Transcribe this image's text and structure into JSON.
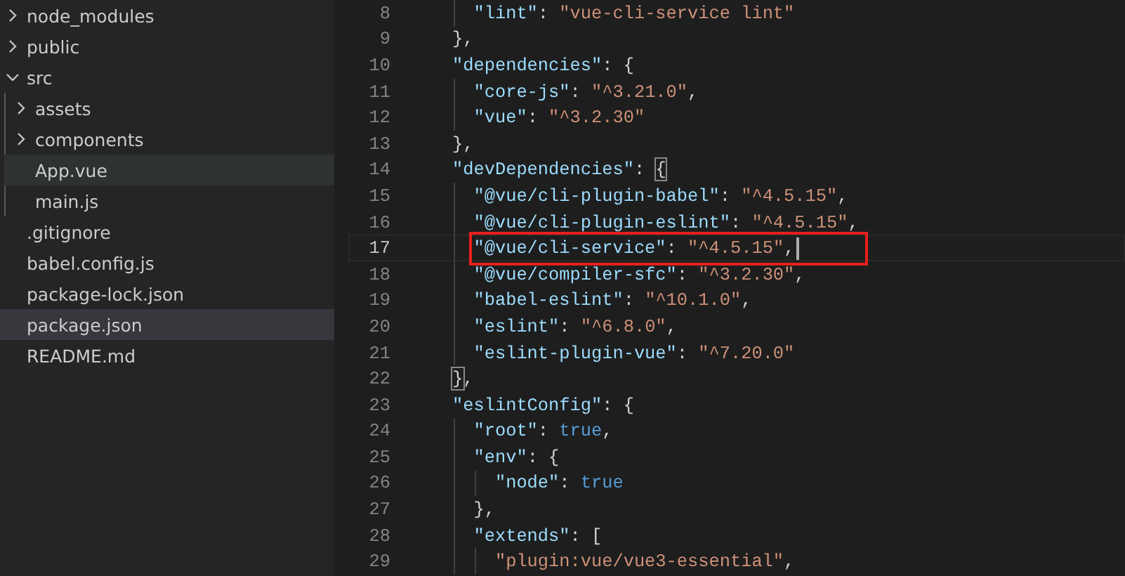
{
  "explorer": {
    "items": [
      {
        "kind": "folder",
        "label": "node_modules",
        "expanded": false,
        "selected": false,
        "hovered": false
      },
      {
        "kind": "folder",
        "label": "public",
        "expanded": false,
        "selected": false,
        "hovered": false
      },
      {
        "kind": "folder",
        "label": "src",
        "expanded": true,
        "selected": false,
        "hovered": false,
        "children": [
          {
            "kind": "folder",
            "label": "assets",
            "expanded": false,
            "selected": false,
            "hovered": false
          },
          {
            "kind": "folder",
            "label": "components",
            "expanded": false,
            "selected": false,
            "hovered": false
          },
          {
            "kind": "file",
            "label": "App.vue",
            "selected": false,
            "hovered": true
          },
          {
            "kind": "file",
            "label": "main.js",
            "selected": false,
            "hovered": false
          }
        ]
      },
      {
        "kind": "file",
        "label": ".gitignore",
        "selected": false,
        "hovered": false
      },
      {
        "kind": "file",
        "label": "babel.config.js",
        "selected": false,
        "hovered": false
      },
      {
        "kind": "file",
        "label": "package-lock.json",
        "selected": false,
        "hovered": false
      },
      {
        "kind": "file",
        "label": "package.json",
        "selected": true,
        "hovered": false
      },
      {
        "kind": "file",
        "label": "README.md",
        "selected": false,
        "hovered": false
      }
    ]
  },
  "editor": {
    "lines": [
      {
        "number": "8",
        "active": false,
        "boxed": false,
        "tokens": [
          {
            "kind": "key",
            "text": "    \"lint\""
          },
          {
            "kind": "punct",
            "text": ": "
          },
          {
            "kind": "string",
            "text": "\"vue-cli-service lint\""
          }
        ]
      },
      {
        "number": "9",
        "active": false,
        "boxed": false,
        "tokens": [
          {
            "kind": "punct",
            "text": "  },"
          }
        ]
      },
      {
        "number": "10",
        "active": false,
        "boxed": false,
        "tokens": [
          {
            "kind": "key",
            "text": "  \"dependencies\""
          },
          {
            "kind": "punct",
            "text": ": {"
          }
        ]
      },
      {
        "number": "11",
        "active": false,
        "boxed": false,
        "tokens": [
          {
            "kind": "key",
            "text": "    \"core-js\""
          },
          {
            "kind": "punct",
            "text": ": "
          },
          {
            "kind": "string",
            "text": "\"^3.21.0\""
          },
          {
            "kind": "punct",
            "text": ","
          }
        ]
      },
      {
        "number": "12",
        "active": false,
        "boxed": false,
        "tokens": [
          {
            "kind": "key",
            "text": "    \"vue\""
          },
          {
            "kind": "punct",
            "text": ": "
          },
          {
            "kind": "string",
            "text": "\"^3.2.30\""
          }
        ]
      },
      {
        "number": "13",
        "active": false,
        "boxed": false,
        "tokens": [
          {
            "kind": "punct",
            "text": "  },"
          }
        ]
      },
      {
        "number": "14",
        "active": false,
        "boxed": false,
        "tokens": [
          {
            "kind": "key",
            "text": "  \"devDependencies\""
          },
          {
            "kind": "punct",
            "text": ": "
          },
          {
            "kind": "bracket",
            "text": "{"
          }
        ]
      },
      {
        "number": "15",
        "active": false,
        "boxed": false,
        "tokens": [
          {
            "kind": "key",
            "text": "    \"@vue/cli-plugin-babel\""
          },
          {
            "kind": "punct",
            "text": ": "
          },
          {
            "kind": "string",
            "text": "\"^4.5.15\""
          },
          {
            "kind": "punct",
            "text": ","
          }
        ]
      },
      {
        "number": "16",
        "active": false,
        "boxed": false,
        "tokens": [
          {
            "kind": "key",
            "text": "    \"@vue/cli-plugin-eslint\""
          },
          {
            "kind": "punct",
            "text": ": "
          },
          {
            "kind": "string",
            "text": "\"^4.5.15\""
          },
          {
            "kind": "punct",
            "text": ","
          }
        ]
      },
      {
        "number": "17",
        "active": true,
        "boxed": true,
        "tokens": [
          {
            "kind": "key",
            "text": "    \"@vue/cli-service\""
          },
          {
            "kind": "punct",
            "text": ": "
          },
          {
            "kind": "string",
            "text": "\"^4.5.15\""
          },
          {
            "kind": "punct",
            "text": ","
          }
        ]
      },
      {
        "number": "18",
        "active": false,
        "boxed": false,
        "tokens": [
          {
            "kind": "key",
            "text": "    \"@vue/compiler-sfc\""
          },
          {
            "kind": "punct",
            "text": ": "
          },
          {
            "kind": "string",
            "text": "\"^3.2.30\""
          },
          {
            "kind": "punct",
            "text": ","
          }
        ]
      },
      {
        "number": "19",
        "active": false,
        "boxed": false,
        "tokens": [
          {
            "kind": "key",
            "text": "    \"babel-eslint\""
          },
          {
            "kind": "punct",
            "text": ": "
          },
          {
            "kind": "string",
            "text": "\"^10.1.0\""
          },
          {
            "kind": "punct",
            "text": ","
          }
        ]
      },
      {
        "number": "20",
        "active": false,
        "boxed": false,
        "tokens": [
          {
            "kind": "key",
            "text": "    \"eslint\""
          },
          {
            "kind": "punct",
            "text": ": "
          },
          {
            "kind": "string",
            "text": "\"^6.8.0\""
          },
          {
            "kind": "punct",
            "text": ","
          }
        ]
      },
      {
        "number": "21",
        "active": false,
        "boxed": false,
        "tokens": [
          {
            "kind": "key",
            "text": "    \"eslint-plugin-vue\""
          },
          {
            "kind": "punct",
            "text": ": "
          },
          {
            "kind": "string",
            "text": "\"^7.20.0\""
          }
        ]
      },
      {
        "number": "22",
        "active": false,
        "boxed": false,
        "tokens": [
          {
            "kind": "bracket",
            "text": "  }"
          },
          {
            "kind": "punct",
            "text": ","
          }
        ]
      },
      {
        "number": "23",
        "active": false,
        "boxed": false,
        "tokens": [
          {
            "kind": "key",
            "text": "  \"eslintConfig\""
          },
          {
            "kind": "punct",
            "text": ": {"
          }
        ]
      },
      {
        "number": "24",
        "active": false,
        "boxed": false,
        "tokens": [
          {
            "kind": "key",
            "text": "    \"root\""
          },
          {
            "kind": "punct",
            "text": ": "
          },
          {
            "kind": "keyword",
            "text": "true"
          },
          {
            "kind": "punct",
            "text": ","
          }
        ]
      },
      {
        "number": "25",
        "active": false,
        "boxed": false,
        "tokens": [
          {
            "kind": "key",
            "text": "    \"env\""
          },
          {
            "kind": "punct",
            "text": ": {"
          }
        ]
      },
      {
        "number": "26",
        "active": false,
        "boxed": false,
        "tokens": [
          {
            "kind": "key",
            "text": "      \"node\""
          },
          {
            "kind": "punct",
            "text": ": "
          },
          {
            "kind": "keyword",
            "text": "true"
          }
        ]
      },
      {
        "number": "27",
        "active": false,
        "boxed": false,
        "tokens": [
          {
            "kind": "punct",
            "text": "    },"
          }
        ]
      },
      {
        "number": "28",
        "active": false,
        "boxed": false,
        "tokens": [
          {
            "kind": "key",
            "text": "    \"extends\""
          },
          {
            "kind": "punct",
            "text": ": ["
          }
        ]
      },
      {
        "number": "29",
        "active": false,
        "boxed": false,
        "tokens": [
          {
            "kind": "string",
            "text": "      \"plugin:vue/vue3-essential\""
          },
          {
            "kind": "punct",
            "text": ","
          }
        ]
      }
    ]
  }
}
